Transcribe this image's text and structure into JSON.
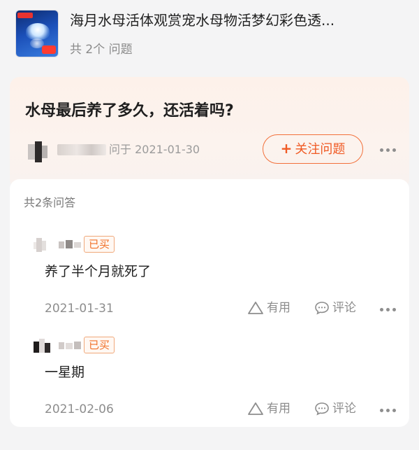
{
  "product": {
    "title": "海月水母活体观赏宠水母物活梦幻彩色透...",
    "question_count": "共 2个 问题"
  },
  "question": {
    "title": "水母最后养了多久，还活着吗?",
    "asked_on": "问于 2021-01-30",
    "follow_label": "关注问题",
    "follow_icon": "plus-icon"
  },
  "answers": {
    "count_label": "共2条问答",
    "items": [
      {
        "badge": "已买",
        "text": "养了半个月就死了",
        "date": "2021-01-31",
        "useful_label": "有用",
        "comment_label": "评论"
      },
      {
        "badge": "已买",
        "text": "一星期",
        "date": "2021-02-06",
        "useful_label": "有用",
        "comment_label": "评论"
      }
    ]
  },
  "colors": {
    "accent": "#f05a24",
    "badge": "#f07028",
    "muted": "#8d8d8d",
    "card_bg": "#fdf1ea"
  }
}
